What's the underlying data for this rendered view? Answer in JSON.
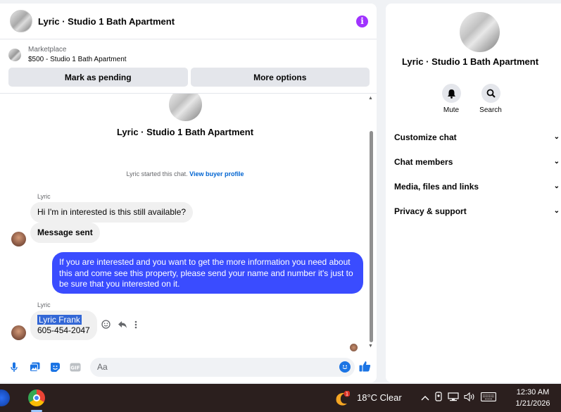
{
  "chat": {
    "title": "Lyric · Studio 1 Bath Apartment",
    "marketplace": {
      "label": "Marketplace",
      "item": "$500 - Studio 1 Bath Apartment"
    },
    "actions": {
      "pending": "Mark as pending",
      "more": "More options"
    },
    "center_title": "Lyric · Studio 1 Bath Apartment",
    "system": {
      "text": "Lyric started this chat.",
      "link": "View buyer profile"
    },
    "messages": [
      {
        "sender": "Lyric",
        "text": "Hi I'm in interested is this still available?"
      },
      {
        "text": "Message sent"
      },
      {
        "text": "If you are interested and you want to get the more information you need about this and come see this property, please send your name and number it's just to be sure that you interested on it."
      },
      {
        "sender": "Lyric",
        "name": "Lyric Frank",
        "phone": "605-454-2047"
      }
    ],
    "composer": {
      "placeholder": "Aa"
    }
  },
  "info": {
    "title": "Lyric · Studio 1 Bath Apartment",
    "mute": "Mute",
    "search": "Search",
    "menu": [
      "Customize chat",
      "Chat members",
      "Media, files and links",
      "Privacy & support"
    ]
  },
  "taskbar": {
    "weather": "18°C  Clear",
    "weather_badge": "1",
    "time": "12:30 AM",
    "date": "1/21/2026"
  },
  "colors": {
    "accent": "#3a4cff",
    "info": "#a033ff",
    "link": "#0064d1"
  }
}
